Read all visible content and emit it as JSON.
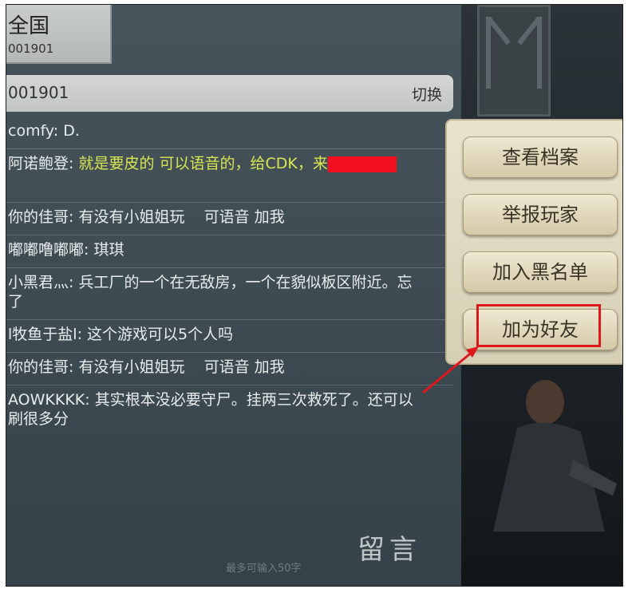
{
  "server": {
    "name": "全国",
    "code": "001901"
  },
  "channel": {
    "code": "001901",
    "switch_label": "切换"
  },
  "messages": [
    {
      "sender": "comfy",
      "sep": ": ",
      "text": "D.",
      "highlight": false
    },
    {
      "sender": "阿诺鲍登",
      "sep": ": ",
      "text": "就是要皮的 可以语音的，给CDK，来",
      "highlight": true,
      "redacted": true
    },
    {
      "sender": "你的佳哥",
      "sep": ": ",
      "text": "有没有小姐姐玩    可语音 加我",
      "highlight": false
    },
    {
      "sender": "嘟嘟噜嘟嘟",
      "sep": ": ",
      "text": "琪琪",
      "highlight": false
    },
    {
      "sender": "小黑君灬",
      "sep": ": ",
      "text": "兵工厂的一个在无敌房，一个在貌似板区附近。忘了",
      "highlight": false
    },
    {
      "sender": "l牧鱼于盐l",
      "sep": ": ",
      "text": "这个游戏可以5个人吗",
      "highlight": false
    },
    {
      "sender": "你的佳哥",
      "sep": ": ",
      "text": "有没有小姐姐玩    可语音 加我",
      "highlight": false
    },
    {
      "sender": "AOWKKKK",
      "sep": ": ",
      "text": "其实根本没必要守尸。挂两三次救死了。还可以刷很多分",
      "highlight": false
    }
  ],
  "footer": {
    "leave_message": "留言",
    "char_limit": "最多可输入50字"
  },
  "menu": {
    "view_profile": "查看档案",
    "report_player": "举报玩家",
    "add_blacklist": "加入黑名单",
    "add_friend": "加为好友"
  },
  "colors": {
    "highlight_text": "#d8e650",
    "annotation_red": "#e0161d",
    "redaction": "#f2101e"
  }
}
